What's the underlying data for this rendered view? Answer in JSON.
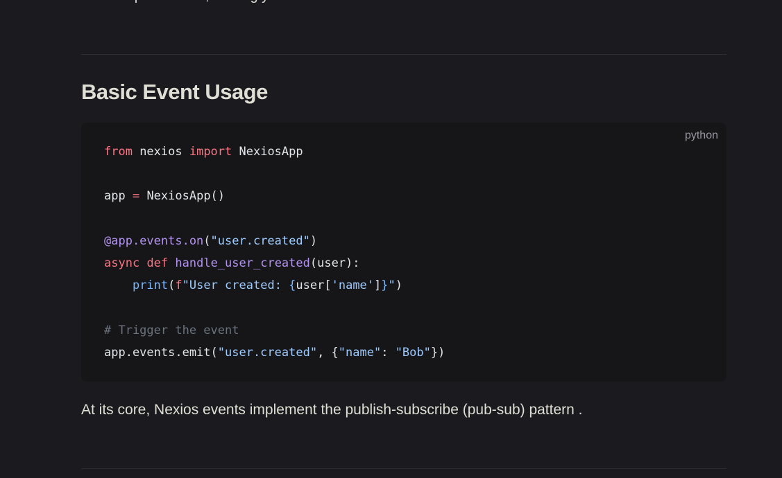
{
  "intro_tail": "direct dependencies, making your code more maintainable and flexible.",
  "section": {
    "title": "Basic Event Usage"
  },
  "code": {
    "language": "python",
    "tokens": {
      "l1_from": "from",
      "l1_nexios": " nexios ",
      "l1_import": "import",
      "l1_cls": " NexiosApp",
      "l3_app": "app ",
      "l3_eq": "=",
      "l3_call": " NexiosApp()",
      "l5_decorator": "@app.events.on",
      "l5_paren_open": "(",
      "l5_str": "\"user.created\"",
      "l5_paren_close": ")",
      "l6_async": "async",
      "l6_space": " ",
      "l6_def": "def",
      "l6_space2": " ",
      "l6_fn": "handle_user_created",
      "l6_params": "(user):",
      "l7_indent": "    ",
      "l7_print": "print",
      "l7_paren_open": "(",
      "l7_f": "f",
      "l7_str1": "\"User created: ",
      "l7_brace_open": "{",
      "l7_user": "user[",
      "l7_key": "'name'",
      "l7_bracket": "]",
      "l7_brace_close": "}",
      "l7_str_end": "\"",
      "l7_paren_close": ")",
      "l9_comment": "# Trigger the event",
      "l10_emit": "app.events.emit(",
      "l10_str1": "\"user.created\"",
      "l10_sep": ", {",
      "l10_key": "\"name\"",
      "l10_colon": ": ",
      "l10_val": "\"Bob\"",
      "l10_end": "})"
    }
  },
  "paragraph": "At its core, Nexios events implement the publish-subscribe (pub-sub) pattern ."
}
